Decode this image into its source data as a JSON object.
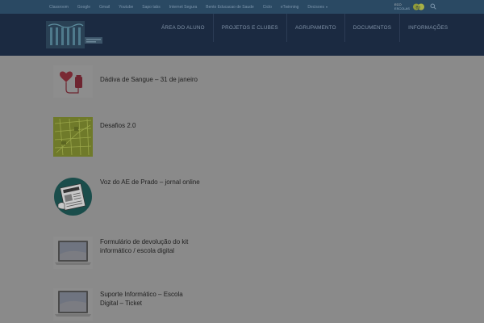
{
  "topbar": {
    "links": [
      {
        "label": "Classroom",
        "dropdown": false
      },
      {
        "label": "Google",
        "dropdown": false
      },
      {
        "label": "Gmail",
        "dropdown": false
      },
      {
        "label": "Youtube",
        "dropdown": false
      },
      {
        "label": "Sapo tabs",
        "dropdown": false
      },
      {
        "label": "Internet Segura",
        "dropdown": false
      },
      {
        "label": "Bento Educacao de Saude",
        "dropdown": false
      },
      {
        "label": "Ciclo",
        "dropdown": false
      },
      {
        "label": "eTwinning",
        "dropdown": false
      },
      {
        "label": "Decisoes",
        "dropdown": true
      }
    ],
    "partner_logo_line1": "ECO",
    "partner_logo_line2": "ESCOLAS",
    "ep_badge": "ep",
    "search_icon": "search-icon"
  },
  "header": {
    "logo_icon": "school-logo",
    "nav": [
      {
        "label": "ÁREA DO ALUNO"
      },
      {
        "label": "PROJETOS E CLUBES"
      },
      {
        "label": "AGRUPAMENTO"
      },
      {
        "label": "DOCUMENTOS"
      },
      {
        "label": "INFORMAÇÕES"
      }
    ]
  },
  "posts": [
    {
      "title": "Dádiva de Sangue – 31 de janeiro",
      "thumb": "blood-donation-icon"
    },
    {
      "title": "Desafios 2.0",
      "thumb": "map-challenge-image"
    },
    {
      "title": "Voz do AE de Prado – jornal online",
      "thumb": "newspaper-icon"
    },
    {
      "title": "Formulário de devolução do kit informático / escola digital",
      "thumb": "laptop-image"
    },
    {
      "title": "Suporte Informático – Escola Digital – Ticket",
      "thumb": "laptop-image"
    }
  ],
  "colors": {
    "page_overlay": "#8a8a8a",
    "topbar": "#2a4963",
    "header": "#1b2a41",
    "nav_text": "#8193a8"
  }
}
